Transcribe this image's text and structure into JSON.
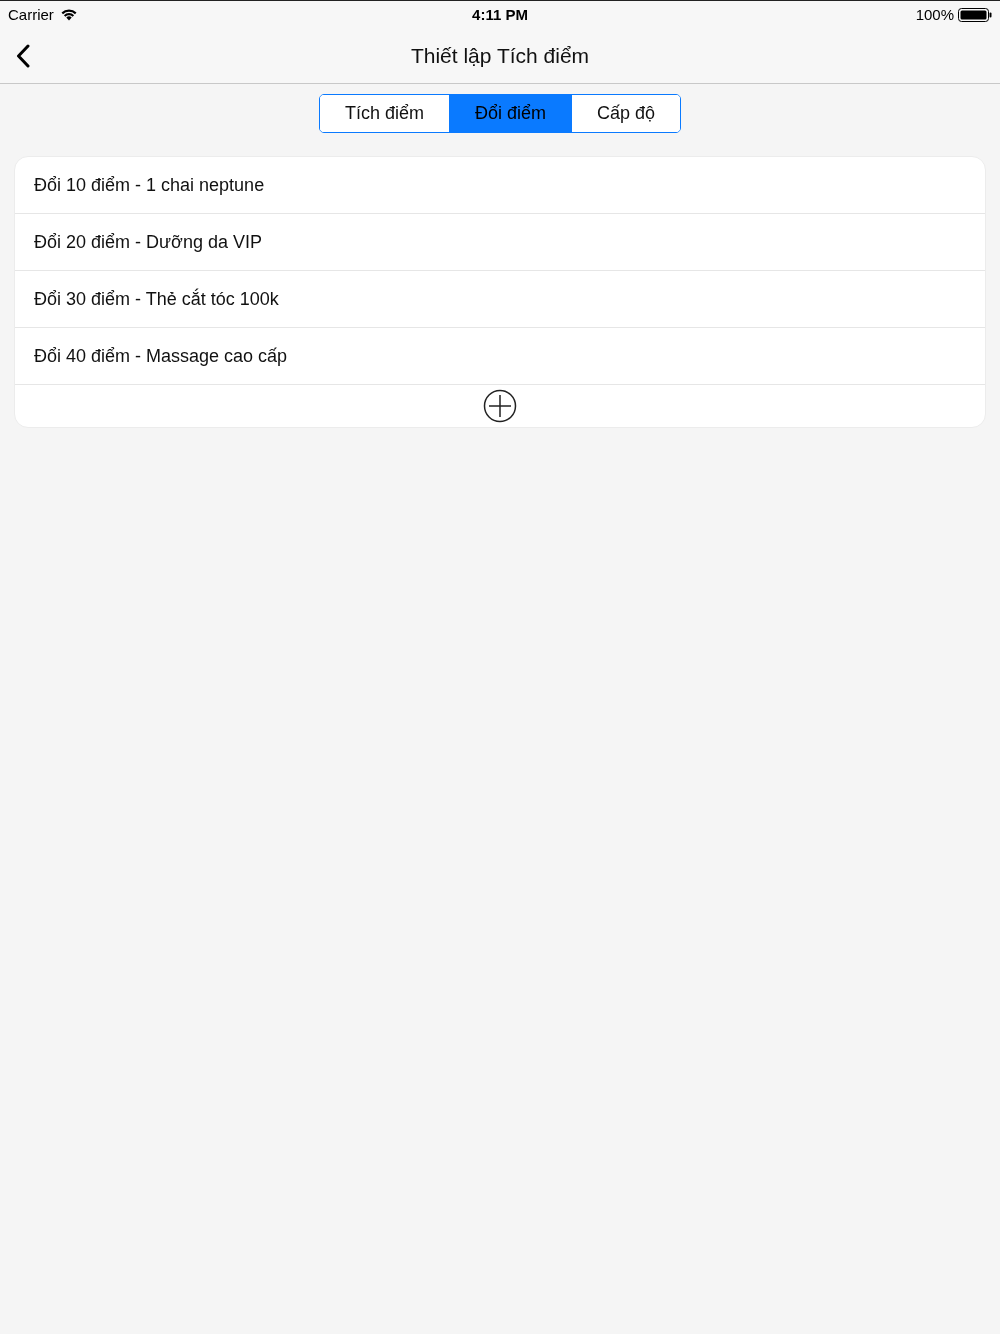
{
  "status_bar": {
    "carrier": "Carrier",
    "time": "4:11 PM",
    "battery": "100%"
  },
  "nav_bar": {
    "title": "Thiết lập Tích điểm"
  },
  "segments": [
    {
      "label": "Tích điểm",
      "selected": false
    },
    {
      "label": "Đổi điểm",
      "selected": true
    },
    {
      "label": "Cấp độ",
      "selected": false
    }
  ],
  "rewards": [
    "Đổi 10 điểm - 1 chai neptune",
    "Đổi 20 điểm - Dưỡng da VIP",
    "Đổi 30 điểm - Thẻ cắt tóc 100k",
    "Đổi 40 điểm - Massage cao cấp"
  ]
}
